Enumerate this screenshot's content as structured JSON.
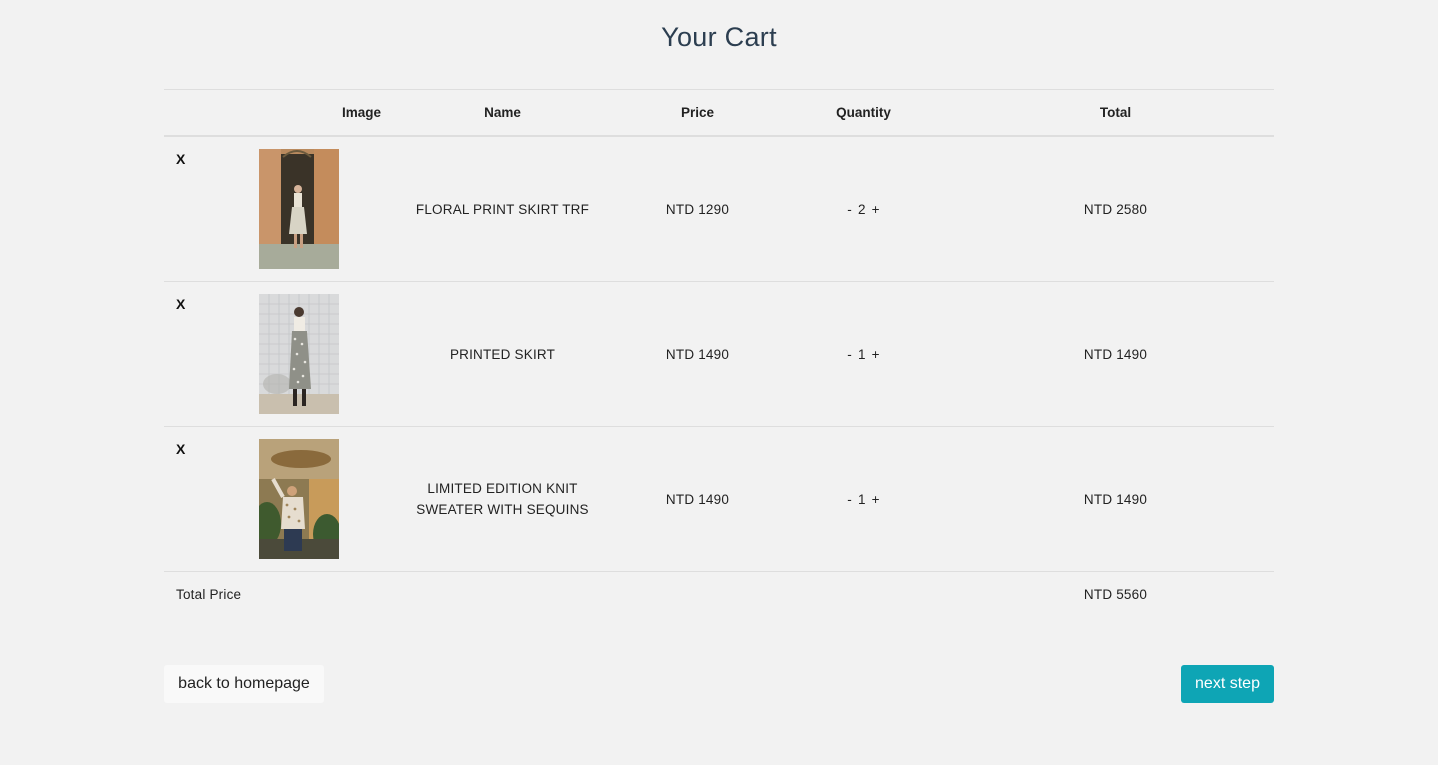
{
  "page": {
    "title": "Your Cart"
  },
  "table": {
    "headers": [
      "",
      "Image",
      "Name",
      "Price",
      "Quantity",
      "Total"
    ],
    "rows": [
      {
        "remove": "X",
        "image_icon": "product-photo-floral-print-skirt",
        "name": "FLORAL PRINT SKIRT TRF",
        "price": "NTD 1290",
        "qty_minus": "-",
        "qty": "2",
        "qty_plus": "+",
        "total": "NTD 2580"
      },
      {
        "remove": "X",
        "image_icon": "product-photo-printed-skirt",
        "name": "PRINTED SKIRT",
        "price": "NTD 1490",
        "qty_minus": "-",
        "qty": "1",
        "qty_plus": "+",
        "total": "NTD 1490"
      },
      {
        "remove": "X",
        "image_icon": "product-photo-knit-sweater",
        "name": "LIMITED EDITION KNIT SWEATER WITH SEQUINS",
        "price": "NTD 1490",
        "qty_minus": "-",
        "qty": "1",
        "qty_plus": "+",
        "total": "NTD 1490"
      }
    ],
    "total_label": "Total Price",
    "total_value": "NTD 5560"
  },
  "actions": {
    "back_label": "back to homepage",
    "next_label": "next step"
  },
  "colors": {
    "background": "#f2f2f2",
    "title": "#2c3e50",
    "accent": "#0ea5b5"
  }
}
